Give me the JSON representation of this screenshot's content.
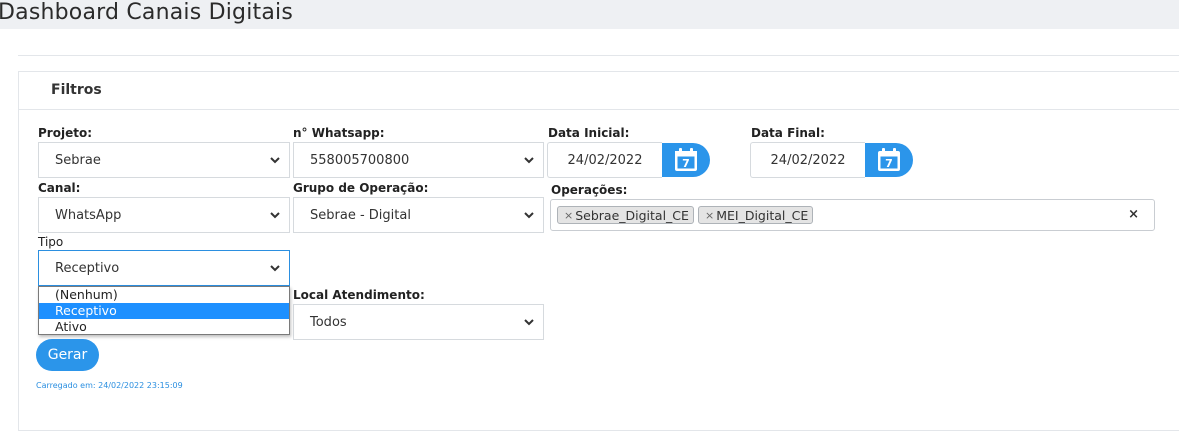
{
  "page": {
    "title": "Dashboard Canais Digitais"
  },
  "filters": {
    "title": "Filtros",
    "projeto": {
      "label": "Projeto:",
      "value": "Sebrae"
    },
    "whatsapp": {
      "label": "n° Whatsapp:",
      "value": "558005700800"
    },
    "data_inicial": {
      "label": "Data Inicial:",
      "value": "24/02/2022"
    },
    "data_final": {
      "label": "Data Final:",
      "value": "24/02/2022"
    },
    "canal": {
      "label": "Canal:",
      "value": "WhatsApp"
    },
    "grupo": {
      "label": "Grupo de Operação:",
      "value": "Sebrae - Digital"
    },
    "operacoes": {
      "label": "Operações:",
      "tags": [
        "Sebrae_Digital_CE",
        "MEI_Digital_CE"
      ],
      "clear": "×",
      "tag_remove": "×"
    },
    "tipo": {
      "label": "Tipo",
      "value": "Receptivo",
      "options": [
        "(Nenhum)",
        "Receptivo",
        "Ativo"
      ],
      "selected_index": 1
    },
    "local": {
      "label": "Local Atendimento:",
      "value": "Todos"
    },
    "gerar_label": "Gerar",
    "loaded_text": "Carregado em: 24/02/2022 23:15:09",
    "calendar_day": "7"
  },
  "colors": {
    "accent": "#2b95ea",
    "selected": "#1e90ff",
    "border": "#d6dade"
  },
  "icons": {
    "chevron": "chevron-down-icon",
    "calendar": "calendar-icon"
  }
}
